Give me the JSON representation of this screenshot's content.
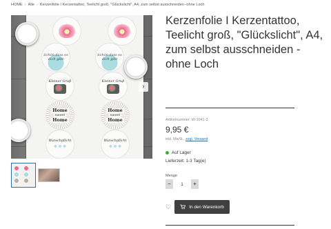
{
  "breadcrumb": {
    "home": "HOME",
    "category": "Alle",
    "current": "Kerzenfolie I Kerzentattoo, Teelicht groß, \"Glückslicht\", A4, zum selbst ausschneiden -ohne Loch",
    "separator": "›"
  },
  "gallery": {
    "prev_arrow": "‹",
    "next_arrow": "›",
    "sticker_text": {
      "blue": "Schön dass es dich gibt",
      "can": "Kleiner Gruß",
      "home_line1": "Home",
      "home_line2": "sweet",
      "home_line3": "Home",
      "wish": "Wunschpflicht"
    }
  },
  "product": {
    "title": "Kerzenfolie I Kerzentattoo, Teelicht groß, \"Glückslicht\", A4, zum selbst ausschneiden -ohne Loch",
    "article_number": "Artikelnummer: W-1041-3",
    "price": "9,95 €",
    "tax_prefix": "inkl. MwSt.,",
    "tax_link": "zzgl. Versand",
    "stock_status": "Auf Lager",
    "delivery_time": "Lieferzeit: 1-3 Tag(e)",
    "quantity_label": "Menge",
    "quantity_value": "1",
    "minus": "−",
    "plus": "+",
    "wishlist_icon": "heart-icon",
    "cart_icon": "cart-icon",
    "cart_button": "In den Warenkorb"
  },
  "colors": {
    "accent_link": "#2b6ea3",
    "stock_green": "#3aaa35",
    "cart_button_bg": "#404040"
  }
}
